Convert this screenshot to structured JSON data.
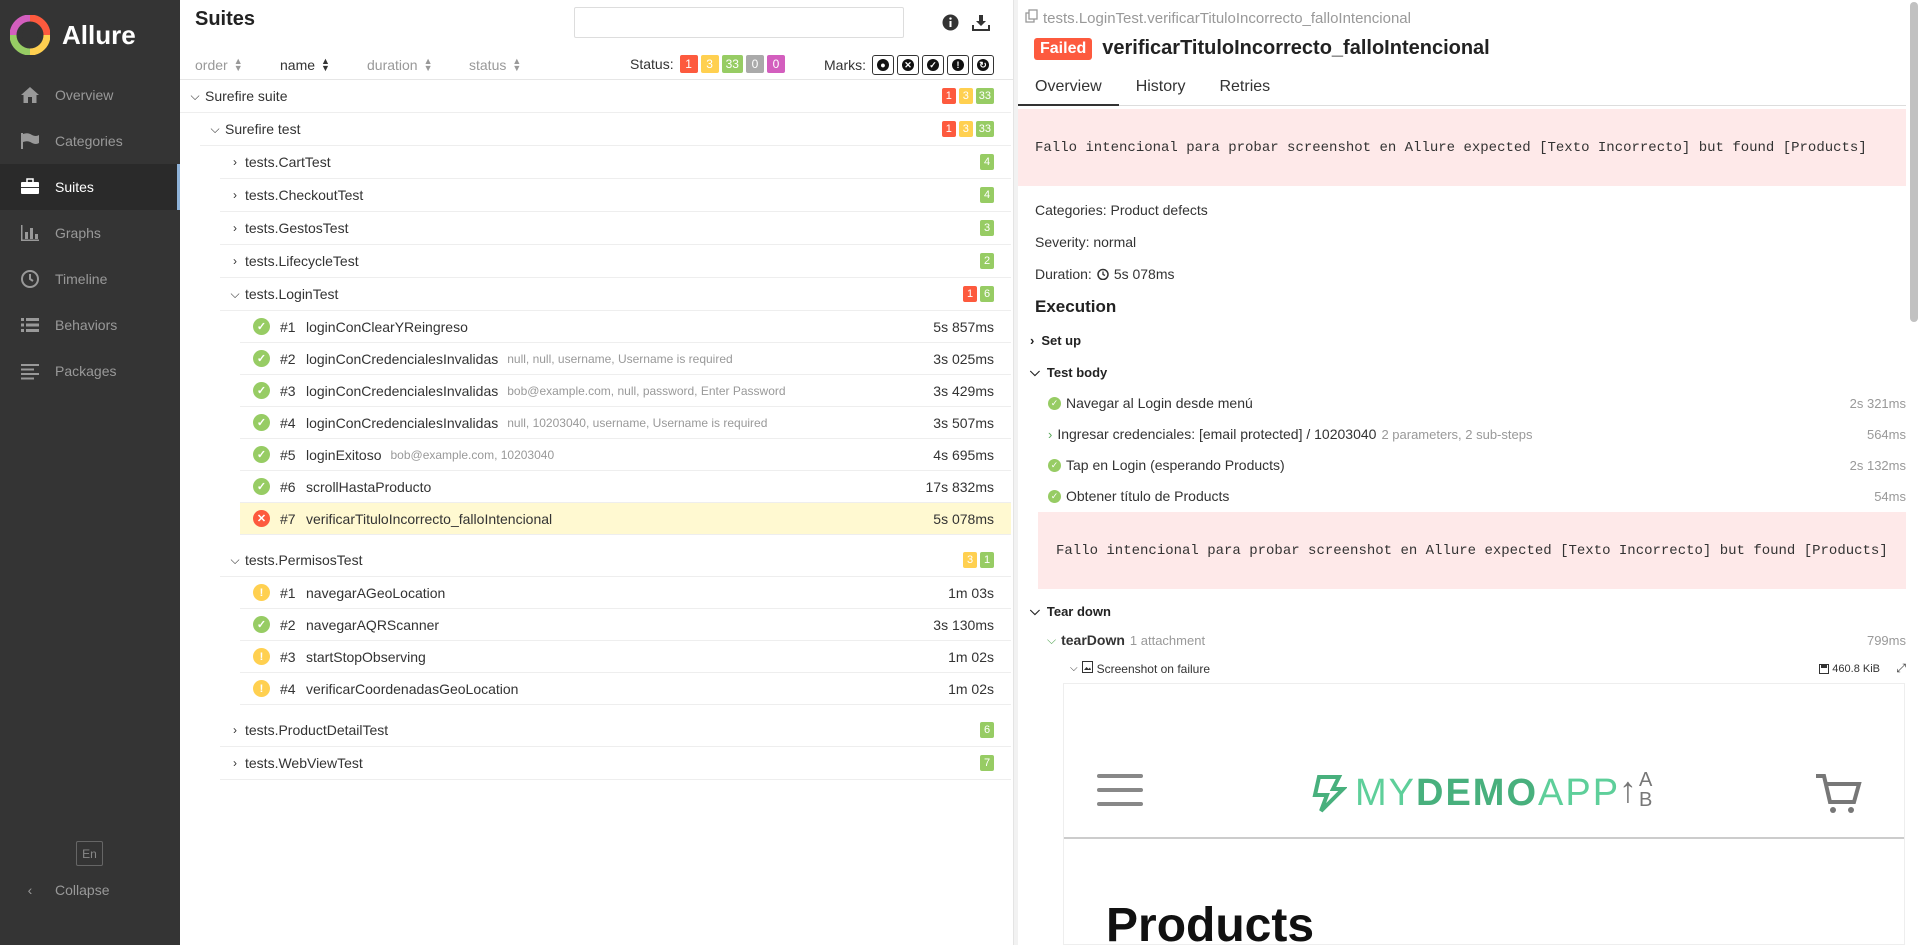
{
  "brand": {
    "name": "Allure"
  },
  "sidebar": {
    "items": [
      {
        "label": "Overview",
        "icon": "home-icon"
      },
      {
        "label": "Categories",
        "icon": "flag-icon"
      },
      {
        "label": "Suites",
        "icon": "briefcase-icon",
        "active": true
      },
      {
        "label": "Graphs",
        "icon": "bar-chart-icon"
      },
      {
        "label": "Timeline",
        "icon": "clock-icon"
      },
      {
        "label": "Behaviors",
        "icon": "list-icon"
      },
      {
        "label": "Packages",
        "icon": "align-left-icon"
      }
    ],
    "lang": "En",
    "collapse": "Collapse"
  },
  "suites": {
    "title": "Suites",
    "search": {
      "value": "",
      "placeholder": ""
    },
    "sort": {
      "order": "order",
      "name": "name",
      "duration": "duration",
      "status": "status"
    },
    "status_label": "Status:",
    "status_counts": {
      "failed": "1",
      "broken": "3",
      "passed": "33",
      "skipped": "0",
      "unknown": "0"
    },
    "marks_label": "Marks:",
    "tree": {
      "root": {
        "name": "Surefire suite",
        "counts": [
          "1",
          "3",
          "33"
        ]
      },
      "sub": {
        "name": "Surefire test",
        "counts": [
          "1",
          "3",
          "33"
        ]
      },
      "classes": {
        "cart": {
          "name": "tests.CartTest",
          "count": "4"
        },
        "checkout": {
          "name": "tests.CheckoutTest",
          "count": "4"
        },
        "gestos": {
          "name": "tests.GestosTest",
          "count": "3"
        },
        "lifecycle": {
          "name": "tests.LifecycleTest",
          "count": "2"
        },
        "login": {
          "name": "tests.LoginTest",
          "failed": "1",
          "passed": "6"
        },
        "permisos": {
          "name": "tests.PermisosTest",
          "broken": "3",
          "passed": "1"
        },
        "productdetail": {
          "name": "tests.ProductDetailTest",
          "count": "6"
        },
        "webview": {
          "name": "tests.WebViewTest",
          "count": "7"
        }
      },
      "login_tests": [
        {
          "num": "#1",
          "name": "loginConClearYReingreso",
          "params": "",
          "dur": "5s 857ms"
        },
        {
          "num": "#2",
          "name": "loginConCredencialesInvalidas",
          "params": "null, null, username, Username is required",
          "dur": "3s 025ms"
        },
        {
          "num": "#3",
          "name": "loginConCredencialesInvalidas",
          "params": "bob@example.com, null, password, Enter Password",
          "dur": "3s 429ms"
        },
        {
          "num": "#4",
          "name": "loginConCredencialesInvalidas",
          "params": "null, 10203040, username, Username is required",
          "dur": "3s 507ms"
        },
        {
          "num": "#5",
          "name": "loginExitoso",
          "params": "bob@example.com, 10203040",
          "dur": "4s 695ms"
        },
        {
          "num": "#6",
          "name": "scrollHastaProducto",
          "params": "",
          "dur": "17s 832ms"
        },
        {
          "num": "#7",
          "name": "verificarTituloIncorrecto_falloIntencional",
          "params": "",
          "dur": "5s 078ms"
        }
      ],
      "permisos_tests": [
        {
          "num": "#1",
          "name": "navegarAGeoLocation",
          "dur": "1m 03s"
        },
        {
          "num": "#2",
          "name": "navegarAQRScanner",
          "dur": "3s 130ms"
        },
        {
          "num": "#3",
          "name": "startStopObserving",
          "dur": "1m 02s"
        },
        {
          "num": "#4",
          "name": "verificarCoordenadasGeoLocation",
          "dur": "1m 02s"
        }
      ]
    }
  },
  "detail": {
    "path": "tests.LoginTest.verificarTituloIncorrecto_falloIntencional",
    "status": "Failed",
    "title": "verificarTituloIncorrecto_falloIntencional",
    "tabs": [
      "Overview",
      "History",
      "Retries"
    ],
    "error": "Fallo intencional para probar screenshot en Allure expected [Texto Incorrecto] but found [Products]",
    "categories": "Categories: Product defects",
    "severity": "Severity: normal",
    "duration_label": "Duration:",
    "duration": "5s 078ms",
    "execution": "Execution",
    "setup": "Set up",
    "body": "Test body",
    "steps": [
      {
        "name": "Navegar al Login desde menú",
        "meta": "",
        "dur": "2s 321ms"
      },
      {
        "name": "Ingresar credenciales: [email protected] / 10203040",
        "meta": "2 parameters, 2 sub-steps",
        "dur": "564ms"
      },
      {
        "name": "Tap en Login (esperando Products)",
        "meta": "",
        "dur": "2s 132ms"
      },
      {
        "name": "Obtener título de Products",
        "meta": "",
        "dur": "54ms"
      }
    ],
    "teardown": "Tear down",
    "teardown_step": {
      "name": "tearDown",
      "meta": "1 attachment",
      "dur": "799ms"
    },
    "attachment": {
      "name": "Screenshot on failure",
      "size": "460.8 KiB"
    },
    "screenshot": {
      "logo_a": "MY",
      "logo_b": "DEMO",
      "logo_c": "APP",
      "sort_a": "A",
      "sort_b": "B",
      "heading": "Products"
    }
  }
}
